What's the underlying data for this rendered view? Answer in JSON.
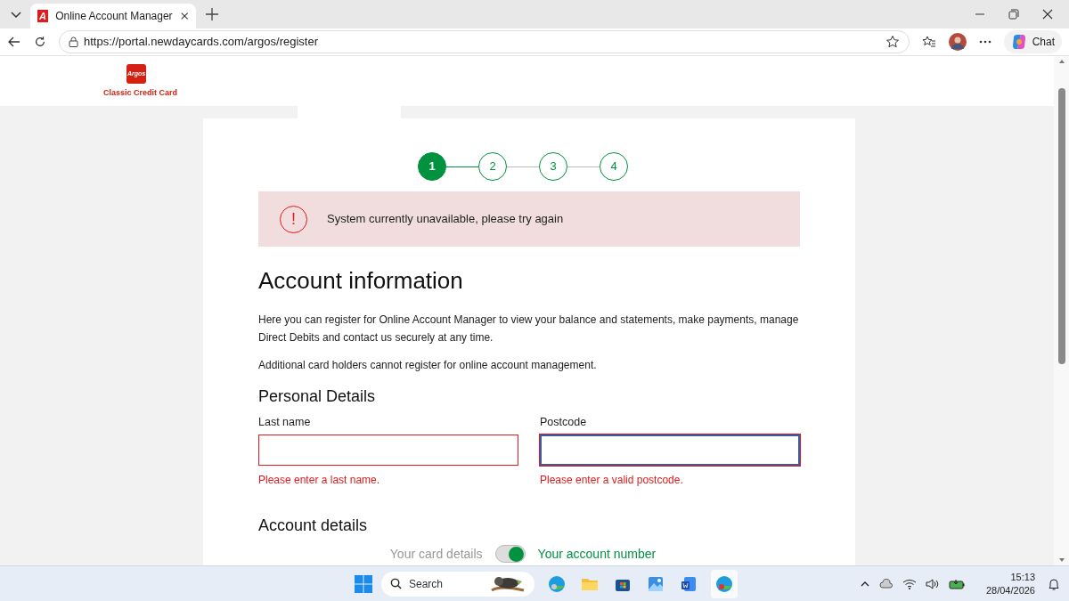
{
  "browser": {
    "favicon": "A",
    "tab_title": "Online Account Manager",
    "url": "https://portal.newdaycards.com/argos/register",
    "chat_label": "Chat"
  },
  "header": {
    "logo_text": "Argos",
    "brand": "Classic Credit Card"
  },
  "steps": [
    {
      "label": "1",
      "selected": true
    },
    {
      "label": "2",
      "selected": false
    },
    {
      "label": "3",
      "selected": false
    },
    {
      "label": "4",
      "selected": false
    }
  ],
  "alert": {
    "icon": "!",
    "message": "System currently unavailable, please try again"
  },
  "heading": "Account information",
  "intro": "Here you can register for Online Account Manager to view your balance and statements, make payments, manage Direct Debits and contact us securely at any time.",
  "note": "Additional card holders cannot register for online account management.",
  "personal_heading": "Personal Details",
  "fields": [
    {
      "label": "Last name",
      "error": "Please enter a last name.",
      "focused": false
    },
    {
      "label": "Postcode",
      "error": "Please enter a valid postcode.",
      "focused": true
    }
  ],
  "account_heading": "Account details",
  "toggle": {
    "left_label": "Your card details",
    "right_label": "Your account number",
    "on": true
  },
  "taskbar": {
    "search_placeholder": "Search",
    "time": "15:13",
    "date": "28/04/2026"
  }
}
